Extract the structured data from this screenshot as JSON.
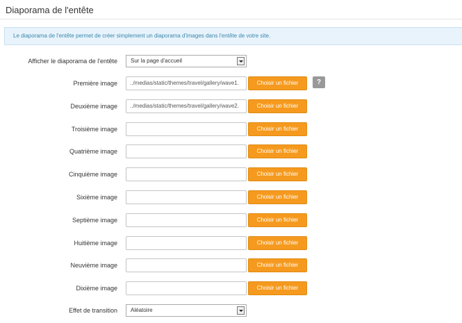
{
  "page": {
    "title": "Diaporama de l'entête",
    "info": "Le diaporama de l'entête permet de créer simplement un diaporama d'images dans l'entête de votre site."
  },
  "show_slideshow": {
    "label": "Afficher le diaporama de l'entête",
    "value": "Sur la page d'accueil"
  },
  "button_label": "Choisir un fichier",
  "help_icon": "?",
  "images": [
    {
      "label": "Première image",
      "value": "../medias/static/themes/travel/gallery/wave1."
    },
    {
      "label": "Deuxième image",
      "value": "../medias/static/themes/travel/gallery/wave2."
    },
    {
      "label": "Troisième image",
      "value": ""
    },
    {
      "label": "Quatrième image",
      "value": ""
    },
    {
      "label": "Cinquième image",
      "value": ""
    },
    {
      "label": "Sixième image",
      "value": ""
    },
    {
      "label": "Septième image",
      "value": ""
    },
    {
      "label": "Huitième image",
      "value": ""
    },
    {
      "label": "Neuvième image",
      "value": ""
    },
    {
      "label": "Dixième image",
      "value": ""
    }
  ],
  "transition": {
    "label": "Effet de transition",
    "value": "Aléatoire"
  },
  "colors": {
    "accent": "#f59a1e",
    "info_bg": "#e8f3fb",
    "info_text": "#3a87ad"
  }
}
